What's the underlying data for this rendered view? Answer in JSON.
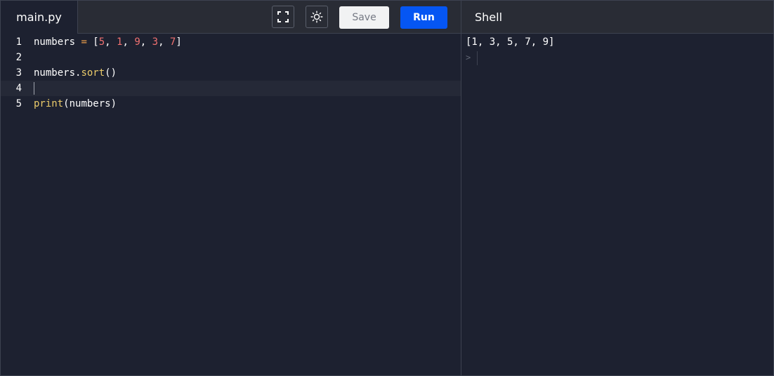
{
  "editor": {
    "file_tab": "main.py",
    "lines": [
      {
        "num": "1",
        "tokens": [
          {
            "t": "numbers ",
            "c": "pl"
          },
          {
            "t": "=",
            "c": "op"
          },
          {
            "t": " [",
            "c": "pl"
          },
          {
            "t": "5",
            "c": "num"
          },
          {
            "t": ", ",
            "c": "pl"
          },
          {
            "t": "1",
            "c": "num"
          },
          {
            "t": ", ",
            "c": "pl"
          },
          {
            "t": "9",
            "c": "num"
          },
          {
            "t": ", ",
            "c": "pl"
          },
          {
            "t": "3",
            "c": "num"
          },
          {
            "t": ", ",
            "c": "pl"
          },
          {
            "t": "7",
            "c": "num"
          },
          {
            "t": "]",
            "c": "pl"
          }
        ]
      },
      {
        "num": "2",
        "tokens": []
      },
      {
        "num": "3",
        "tokens": [
          {
            "t": "numbers.",
            "c": "pl"
          },
          {
            "t": "sort",
            "c": "fn"
          },
          {
            "t": "()",
            "c": "pl"
          }
        ]
      },
      {
        "num": "4",
        "tokens": [],
        "active": true
      },
      {
        "num": "5",
        "tokens": [
          {
            "t": "print",
            "c": "fn"
          },
          {
            "t": "(numbers)",
            "c": "pl"
          }
        ]
      }
    ]
  },
  "toolbar": {
    "fullscreen_icon": "fullscreen-icon",
    "theme_icon": "sun-icon",
    "save_label": "Save",
    "run_label": "Run"
  },
  "shell": {
    "title": "Shell",
    "output_line": "[1, 3, 5, 7, 9]",
    "prompt": ">"
  },
  "colors": {
    "editor_bg": "#1d2130",
    "topbar_bg": "#292c35",
    "run_accent": "#0556f3",
    "number_token": "#f07171",
    "operator_token": "#f0a04b",
    "function_token": "#ebcb6a"
  }
}
